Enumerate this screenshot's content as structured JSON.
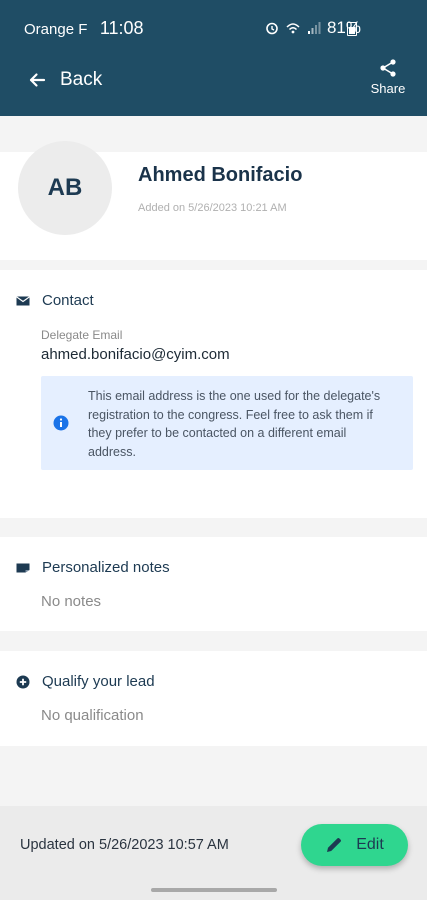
{
  "status_bar": {
    "carrier": "Orange F",
    "time": "11:08",
    "battery": "81%"
  },
  "header": {
    "back_label": "Back",
    "share_label": "Share"
  },
  "profile": {
    "initials": "AB",
    "name": "Ahmed Bonifacio",
    "added": "Added on 5/26/2023 10:21 AM"
  },
  "contact": {
    "title": "Contact",
    "email_label": "Delegate Email",
    "email": "ahmed.bonifacio@cyim.com",
    "info": "This email address is the one used for the delegate's registration to the congress. Feel free to ask them if they prefer to be contacted on a different email address."
  },
  "notes": {
    "title": "Personalized notes",
    "value": "No notes"
  },
  "qualify": {
    "title": "Qualify your lead",
    "value": "No qualification"
  },
  "footer": {
    "updated": "Updated on 5/26/2023 10:57 AM",
    "edit_label": "Edit"
  },
  "colors": {
    "header_bg": "#1f4d65",
    "accent": "#2fd68f",
    "info_bg": "#e5efff",
    "info_icon": "#1a73e8"
  }
}
